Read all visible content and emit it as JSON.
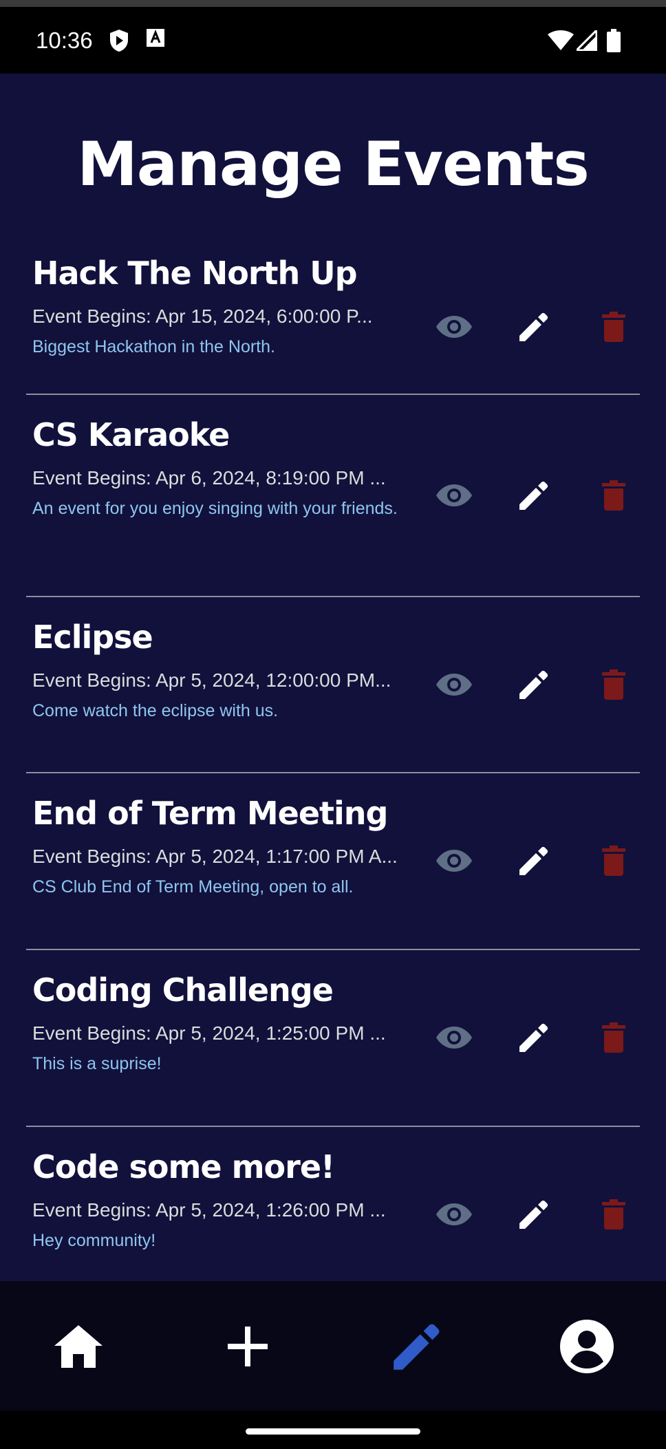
{
  "status_bar": {
    "time": "10:36",
    "left_icons": [
      "shield-play-icon",
      "font-a-icon"
    ],
    "right_icons": [
      "wifi-icon",
      "signal-icon",
      "battery-icon"
    ]
  },
  "page": {
    "title": "Manage Events"
  },
  "events": [
    {
      "name": "Hack The North Up",
      "begins": "Event Begins: Apr 15, 2024, 6:00:00 P...",
      "description": "Biggest Hackathon in the North."
    },
    {
      "name": "CS Karaoke",
      "begins": "Event Begins: Apr 6, 2024, 8:19:00 PM ...",
      "description": "An event for you enjoy singing with your friends."
    },
    {
      "name": "Eclipse",
      "begins": "Event Begins: Apr 5, 2024, 12:00:00 PM...",
      "description": "Come watch the eclipse with us."
    },
    {
      "name": "End of Term Meeting",
      "begins": "Event Begins: Apr 5, 2024, 1:17:00 PM A...",
      "description": "CS Club End of Term Meeting, open to all."
    },
    {
      "name": "Coding Challenge",
      "begins": "Event Begins: Apr 5, 2024, 1:25:00 PM ...",
      "description": "This is a suprise!"
    },
    {
      "name": "Code some more!",
      "begins": "Event Begins: Apr 5, 2024, 1:26:00 PM ...",
      "description": "Hey community!"
    }
  ],
  "row_actions": [
    "view-icon",
    "edit-icon",
    "delete-icon"
  ],
  "bottom_nav": {
    "items": [
      "home-icon",
      "add-icon",
      "edit-icon",
      "account-icon"
    ],
    "active": "edit-icon"
  },
  "colors": {
    "background": "#11113c",
    "nav_background": "#070717",
    "title": "#ffffff",
    "description": "#8fc6ee",
    "view_icon": "#5f6f86",
    "delete_icon": "#7c1a1a",
    "active_nav": "#2f5cc8"
  }
}
